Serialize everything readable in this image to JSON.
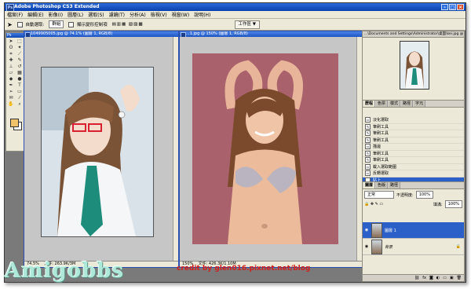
{
  "app": {
    "title": "Adobe Photoshop CS3 Extended",
    "menu": [
      "檔案(F)",
      "編輯(E)",
      "影像(I)",
      "圖層(L)",
      "選取(S)",
      "濾鏡(T)",
      "分析(A)",
      "檢視(V)",
      "視窗(W)",
      "說明(H)"
    ],
    "options": {
      "auto_select": "自動選取:",
      "auto_select_value": "群組",
      "show_transform": "顯示變形控制項",
      "workspace_label": "工作區 ▼"
    }
  },
  "documents": [
    {
      "title": "1049905005.jpg @ 74.1% (圖層 1, RGB/8)",
      "zoom": "74.5%",
      "status": "文件: 263.9K/3M"
    },
    {
      "title": "...1.jpg @ 150% (圖層 1, RGB/8)",
      "zoom": "150%",
      "status": "文件: 426.3K/1.10M"
    }
  ],
  "navigator": {
    "title": "...\\Documents and Settings\\Administrator\\桌面\\kei.jpg @ 50% (圖層 1, RGB/8)"
  },
  "history_panel": {
    "tabs": [
      "歷程",
      "色票",
      "樣式",
      "路徑",
      "字元"
    ],
    "items": [
      {
        "label": "淡化選取",
        "icon": "▭"
      },
      {
        "label": "筆刷工具",
        "icon": "✎"
      },
      {
        "label": "筆刷工具",
        "icon": "✎"
      },
      {
        "label": "筆刷工具",
        "icon": "✎"
      },
      {
        "label": "描邊",
        "icon": "▭"
      },
      {
        "label": "筆刷工具",
        "icon": "✎"
      },
      {
        "label": "筆刷工具",
        "icon": "✎"
      },
      {
        "label": "載入選取範圍",
        "icon": "▭"
      },
      {
        "label": "反轉選取",
        "icon": "▭"
      },
      {
        "label": "貼上",
        "icon": "▭"
      }
    ],
    "selected_index": 9
  },
  "layers_panel": {
    "tabs": [
      "圖層",
      "色版",
      "路徑"
    ],
    "blend_mode": "正常",
    "opacity_label": "不透明度:",
    "opacity_value": "100%",
    "fill_label": "填滿:",
    "fill_value": "100%",
    "layers": [
      {
        "name": "圖層 1",
        "visible": true,
        "selected": true
      },
      {
        "name": "背景",
        "visible": true,
        "selected": false
      }
    ]
  },
  "overlay": {
    "watermark": "Amigobbs",
    "credit": "credit by glen016.pixnet.net/blog"
  },
  "colors": {
    "title_bar": "#0a40b0",
    "selection": "#2b60c8",
    "credit_text": "#d02020",
    "foreground_swatch": "#f0c36a"
  }
}
